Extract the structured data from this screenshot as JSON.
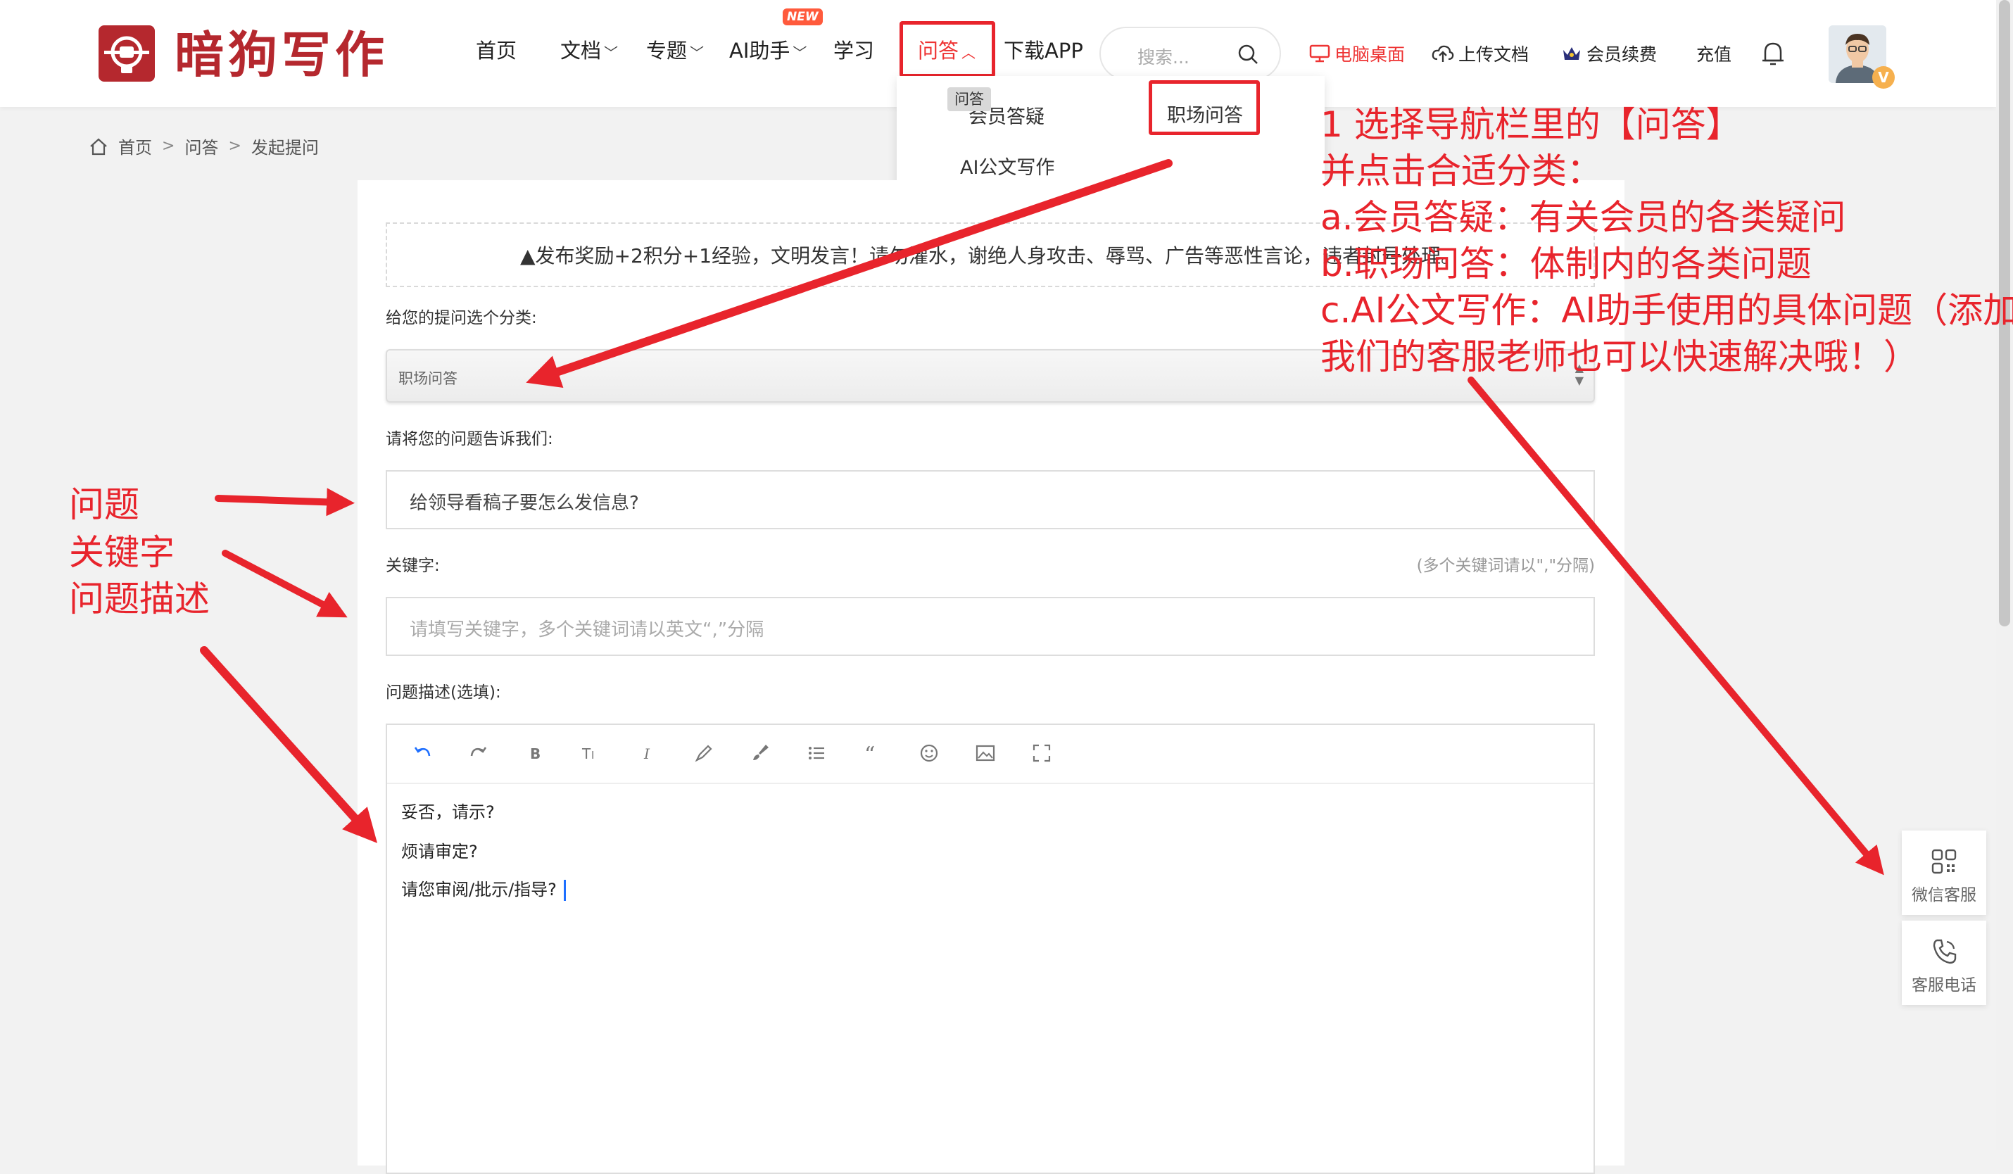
{
  "header": {
    "logo_text": "暗狗写作",
    "nav": [
      {
        "label": "首页",
        "has_dropdown": false
      },
      {
        "label": "文档",
        "has_dropdown": true
      },
      {
        "label": "专题",
        "has_dropdown": true
      },
      {
        "label": "AI助手",
        "has_dropdown": true,
        "badge": "NEW"
      },
      {
        "label": "学习",
        "has_dropdown": false
      },
      {
        "label": "问答",
        "has_dropdown": true,
        "active": true
      },
      {
        "label": "下载APP",
        "has_dropdown": false
      }
    ],
    "search_placeholder": "搜索...",
    "links": {
      "desktop": "电脑桌面",
      "upload": "上传文档",
      "membership": "会员续费",
      "recharge": "充值"
    },
    "vip_badge": "V"
  },
  "dropdown": {
    "tooltip": "问答",
    "items": [
      "会员答疑",
      "职场问答",
      "AI公文写作"
    ]
  },
  "breadcrumb": [
    "首页",
    "问答",
    "发起提问"
  ],
  "form": {
    "notice": "发布奖励+2积分+1经验，文明发言！请勿灌水，谢绝人身攻击、辱骂、广告等恶性言论，违者封号处理。",
    "category_label": "给您的提问选个分类:",
    "category_value": "职场问答",
    "question_label": "请将您的问题告诉我们:",
    "question_value": "给领导看稿子要怎么发信息?",
    "keyword_label": "关键字:",
    "keyword_hint": "(多个关键词请以\",\"分隔)",
    "keyword_placeholder": "请填写关键字，多个关键词请以英文“,”分隔",
    "description_label": "问题描述(选填):",
    "editor_lines": [
      "妥否，请示?",
      "烦请审定?",
      "请您审阅/批示/指导?"
    ]
  },
  "side_widgets": {
    "wechat": "微信客服",
    "phone": "客服电话"
  },
  "annotations": {
    "right": [
      "1 选择导航栏里的【问答】",
      "并点击合适分类：",
      "a.会员答疑：有关会员的各类疑问",
      "b.职场问答：体制内的各类问题",
      "c.AI公文写作：AI助手使用的具体问题（添加",
      "我们的客服老师也可以快速解决哦！）"
    ],
    "left": [
      "问题",
      "关键字",
      "问题描述"
    ]
  },
  "colors": {
    "brand": "#b5282e",
    "accent_red": "#e8242c",
    "link_blue": "#1e6fff"
  }
}
